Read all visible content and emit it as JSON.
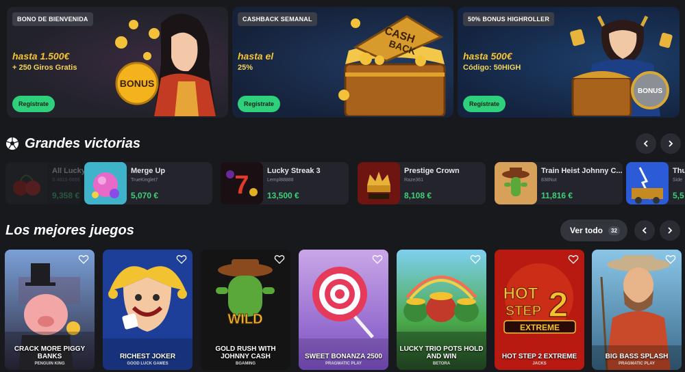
{
  "promos": [
    {
      "badge": "BONO DE BIENVENIDA",
      "amount": "hasta 1.500€",
      "sub": "+ 250 Giros Gratis",
      "button": "Regístrate"
    },
    {
      "badge": "CASHBACK SEMANAL",
      "amount": "hasta el",
      "sub": "25%",
      "button": "Regístrate"
    },
    {
      "badge": "50% BONUS HIGHROLLER",
      "amount": "hasta 500€",
      "sub": "Código: 50HIGH",
      "button": "Regístrate"
    }
  ],
  "art_text": {
    "bonus": "BONUS",
    "cash": "CASH",
    "back": "BACK"
  },
  "big_wins": {
    "title": "Grandes victorias",
    "items": [
      {
        "game": "All Lucky",
        "user": "S·4819·6666",
        "amount": "9,358 €"
      },
      {
        "game": "Merge Up",
        "user": "TrueKinglet7",
        "amount": "5,070 €"
      },
      {
        "game": "Lucky Streak 3",
        "user": "Lempl88888",
        "amount": "13,500 €"
      },
      {
        "game": "Prestige Crown",
        "user": "Raze361",
        "amount": "8,108 €"
      },
      {
        "game": "Train Heist Johnny C...",
        "user": "838Nut",
        "amount": "11,816 €"
      },
      {
        "game": "Thu",
        "user": "Side",
        "amount": "5,5"
      }
    ]
  },
  "top_games": {
    "title": "Los mejores juegos",
    "view_all": "Ver todo",
    "count": "32",
    "items": [
      {
        "title": "CRACK MORE PIGGY BANKS",
        "provider": "PENGUIN KING"
      },
      {
        "title": "RICHEST JOKER",
        "provider": "GOOD LUCK GAMES"
      },
      {
        "title": "GOLD RUSH WITH JOHNNY CASH",
        "provider": "BGAMING"
      },
      {
        "title": "SWEET BONANZA 2500",
        "provider": "PRAGMATIC PLAY"
      },
      {
        "title": "LUCKY TRIO POTS HOLD AND WIN",
        "provider": "BETORA"
      },
      {
        "title": "HOT STEP 2 EXTREME",
        "provider": "JACKS"
      },
      {
        "title": "BIG BASS SPLASH",
        "provider": "PRAGMATIC PLAY"
      }
    ]
  },
  "card_art": {
    "wild": "WILD",
    "hot": "HOT",
    "step": "STEP",
    "num": "2",
    "extreme": "EXTREME"
  },
  "icons": {
    "prev": "chevron-left-icon",
    "next": "chevron-right-icon",
    "favorite": "heart-icon",
    "wins": "soccer-ball-icon"
  },
  "colors": {
    "accent_green": "#2fd07c",
    "win_amount": "#3ed17a",
    "promo_gold": "#f7c531"
  }
}
